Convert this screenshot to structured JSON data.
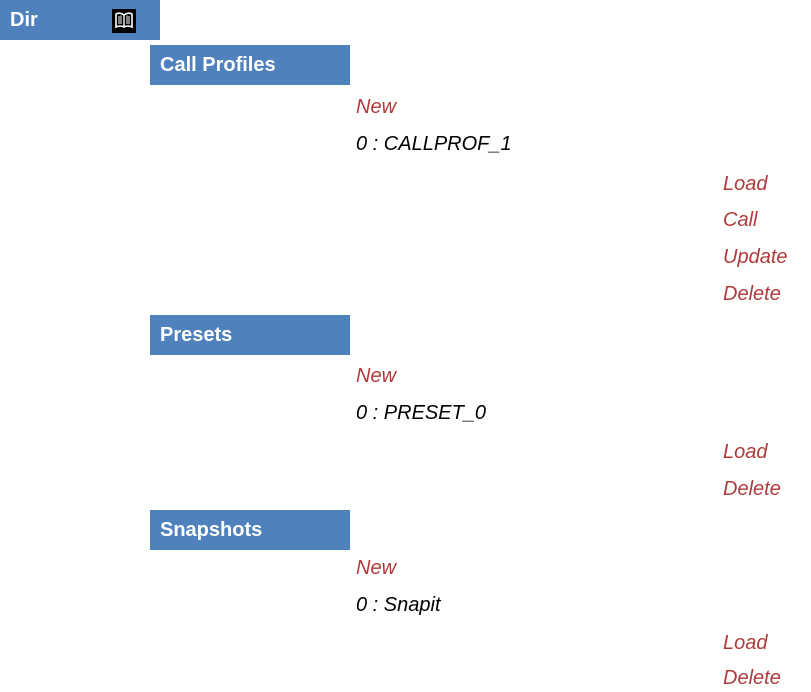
{
  "dir": {
    "label": "Dir",
    "icon": "book-icon"
  },
  "sections": [
    {
      "title": "Call Profiles",
      "new_label": "New",
      "entry": "0 : CALLPROF_1",
      "actions": [
        "Load",
        "Call",
        "Update",
        "Delete"
      ]
    },
    {
      "title": "Presets",
      "new_label": "New",
      "entry": "0 : PRESET_0",
      "actions": [
        "Load",
        "Delete"
      ]
    },
    {
      "title": "Snapshots",
      "new_label": "New",
      "entry": "0 : Snapit",
      "actions": [
        "Load",
        "Delete"
      ]
    }
  ],
  "colors": {
    "header_bg": "#4f81bd",
    "header_text": "#ffffff",
    "action_text": "#b03a3a",
    "entry_text": "#000000"
  }
}
